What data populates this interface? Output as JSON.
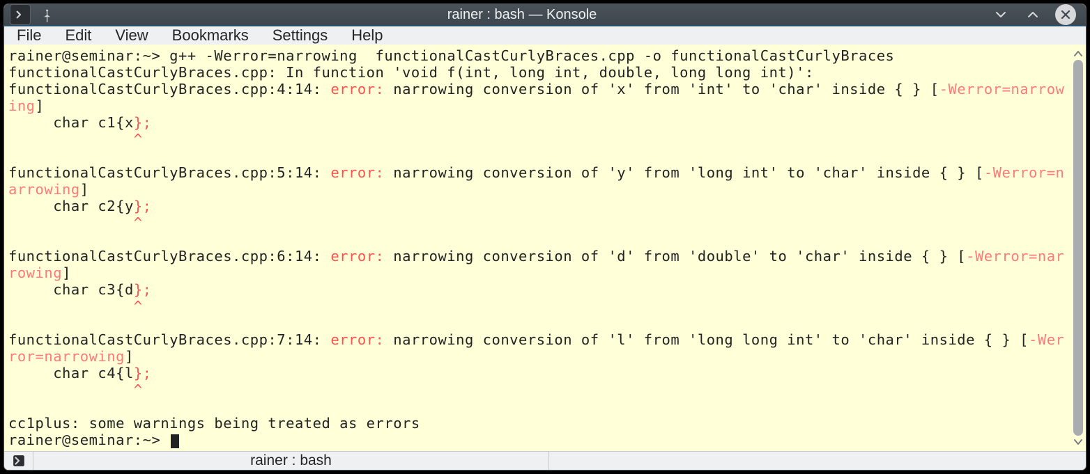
{
  "window": {
    "title": "rainer : bash — Konsole"
  },
  "menubar": {
    "items": [
      "File",
      "Edit",
      "View",
      "Bookmarks",
      "Settings",
      "Help"
    ]
  },
  "tab": {
    "label": "rainer : bash"
  },
  "terminal": {
    "prompt1": "rainer@seminar:~> ",
    "command": "g++ -Werror=narrowing  functionalCastCurlyBraces.cpp -o functionalCastCurlyBraces",
    "line2": "functionalCastCurlyBraces.cpp: In function 'void f(int, long int, double, long long int)':",
    "err1_loc": "functionalCastCurlyBraces.cpp:4:14: ",
    "error_label": "error:",
    "err1_msg": " narrowing conversion of 'x' from 'int' to 'char' inside { } [",
    "werror_flag": "-Werror=narrowing",
    "close_bracket": "]",
    "code1": "     char c1{x",
    "brace_semi": "};",
    "caret_line": "              ^",
    "err2_loc": "functionalCastCurlyBraces.cpp:5:14: ",
    "err2_msg": " narrowing conversion of 'y' from 'long int' to 'char' inside { } [",
    "code2": "     char c2{y",
    "err3_loc": "functionalCastCurlyBraces.cpp:6:14: ",
    "err3_msg": " narrowing conversion of 'd' from 'double' to 'char' inside { } [",
    "code3": "     char c3{d",
    "err4_loc": "functionalCastCurlyBraces.cpp:7:14: ",
    "err4_msg": " narrowing conversion of 'l' from 'long long int' to 'char' inside { } [",
    "code4": "     char c4{l",
    "footer1": "cc1plus: some warnings being treated as errors",
    "prompt2": "rainer@seminar:~> "
  }
}
